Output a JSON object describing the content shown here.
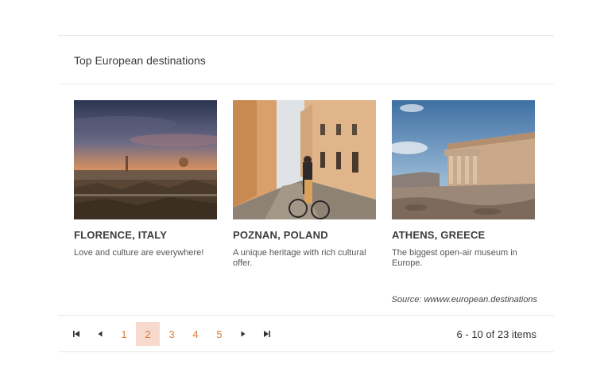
{
  "header": {
    "title": "Top European destinations"
  },
  "destinations": [
    {
      "title": "FLORENCE, ITALY",
      "description": "Love and culture are everywhere!",
      "image": "florence-photo"
    },
    {
      "title": "POZNAN, POLAND",
      "description": "A unique heritage with rich cultural offer.",
      "image": "poznan-photo"
    },
    {
      "title": "ATHENS, GREECE",
      "description": "The biggest open-air museum in Europe.",
      "image": "athens-photo"
    }
  ],
  "source": "Source: wwww.european.destinations",
  "pager": {
    "pages": [
      "1",
      "2",
      "3",
      "4",
      "5"
    ],
    "current_page": "2",
    "info": "6 - 10 of 23 items",
    "accent_color": "#e07b39",
    "active_bg": "#f7d9cd"
  },
  "icons": {
    "first": "first-page-icon",
    "prev": "previous-page-icon",
    "next": "next-page-icon",
    "last": "last-page-icon"
  }
}
